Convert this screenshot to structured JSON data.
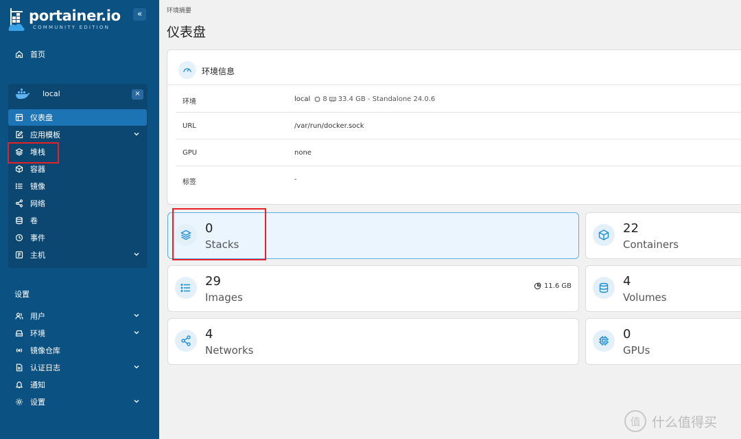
{
  "brand": {
    "name": "portainer.io",
    "edition": "COMMUNITY EDITION",
    "collapse_glyph": "«"
  },
  "sidebar": {
    "home_label": "首页",
    "env_name": "local",
    "env_close": "×",
    "env_items": [
      {
        "label": "仪表盘",
        "icon": "dashboard-icon",
        "active": true
      },
      {
        "label": "应用模板",
        "icon": "edit-icon",
        "chevron": true
      },
      {
        "label": "堆栈",
        "icon": "layers-icon"
      },
      {
        "label": "容器",
        "icon": "box-icon"
      },
      {
        "label": "镜像",
        "icon": "list-icon"
      },
      {
        "label": "网络",
        "icon": "share-icon"
      },
      {
        "label": "卷",
        "icon": "database-icon"
      },
      {
        "label": "事件",
        "icon": "clock-icon"
      },
      {
        "label": "主机",
        "icon": "host-icon",
        "chevron": true
      }
    ],
    "settings_title": "设置",
    "settings_items": [
      {
        "label": "用户",
        "icon": "users-icon",
        "chevron": true
      },
      {
        "label": "环境",
        "icon": "hdd-icon",
        "chevron": true
      },
      {
        "label": "镜像仓库",
        "icon": "radio-icon"
      },
      {
        "label": "认证日志",
        "icon": "file-icon",
        "chevron": true
      },
      {
        "label": "通知",
        "icon": "bell-icon"
      },
      {
        "label": "设置",
        "icon": "gear-icon",
        "chevron": true
      }
    ]
  },
  "main": {
    "breadcrumb": "环境摘要",
    "title": "仪表盘",
    "info": {
      "title": "环境信息",
      "rows": [
        {
          "key": "环境",
          "value": "local",
          "cpu": "8",
          "memory": "33.4 GB - Standalone 24.0.6"
        },
        {
          "key": "URL",
          "value": "/var/run/docker.sock"
        },
        {
          "key": "GPU",
          "value": "none"
        },
        {
          "key": "标签",
          "value": "-"
        }
      ]
    },
    "stats": [
      {
        "value": "0",
        "label": "Stacks",
        "icon": "layers-icon",
        "selected": true
      },
      {
        "value": "22",
        "label": "Containers",
        "icon": "box-icon"
      },
      {
        "value": "29",
        "label": "Images",
        "icon": "list-icon",
        "side": "11.6 GB"
      },
      {
        "value": "4",
        "label": "Volumes",
        "icon": "database-icon"
      },
      {
        "value": "4",
        "label": "Networks",
        "icon": "share-icon"
      },
      {
        "value": "0",
        "label": "GPUs",
        "icon": "cpu-icon"
      }
    ]
  },
  "watermark": {
    "glyph": "值",
    "text": "什么值得买"
  },
  "colors": {
    "sidebar": "#0b5181",
    "env_panel": "#0c4771",
    "active": "#1d74b4",
    "accent": "#1d8fd6",
    "highlight": "#e8202a"
  }
}
